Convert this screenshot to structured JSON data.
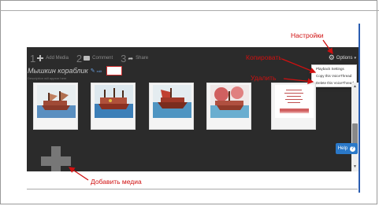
{
  "steps": [
    {
      "num": "1",
      "label": "Add Media"
    },
    {
      "num": "2",
      "label": "Comment"
    },
    {
      "num": "3",
      "label": "Share"
    }
  ],
  "voicethread": {
    "title": "Мышкин кораблик",
    "edit_label": "edit",
    "subtitle": "Description will appear here"
  },
  "options": {
    "label": "Options",
    "menu": [
      "Playback Settings",
      "Copy this VoiceThread",
      "Delete this VoiceThread"
    ]
  },
  "help": {
    "label": "Help",
    "q": "?"
  },
  "scroll": {
    "up": "▲",
    "down": "▼"
  },
  "annotations": {
    "settings": "Настройки",
    "copy": "Копировать",
    "delete": "Удалить",
    "add_media": "Добавить медиа"
  },
  "colors": {
    "annotation": "#d01010",
    "app_bg": "#2b2b2b",
    "help_bg": "#2a78c8"
  },
  "icons": {
    "add": "plus-icon",
    "comment": "comment-bubble-icon",
    "share": "share-arrow-icon",
    "settings": "gear-icon"
  }
}
